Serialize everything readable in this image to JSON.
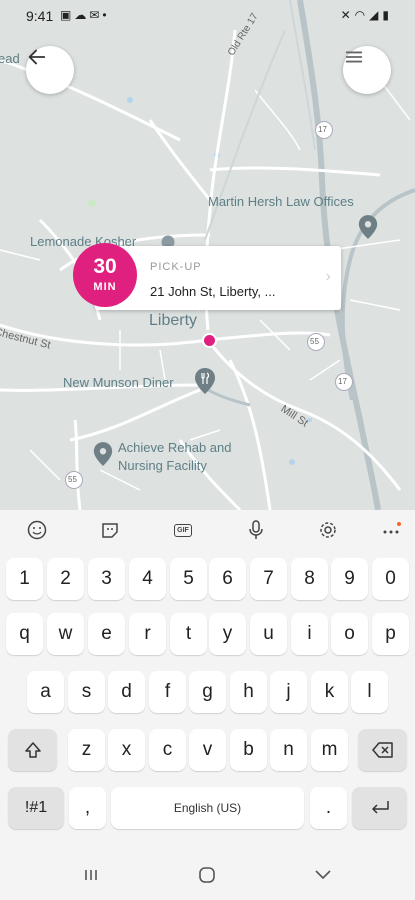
{
  "status_bar": {
    "time": "9:41",
    "left_icons": [
      "image-icon",
      "cloud-icon",
      "mail-icon",
      "dot-icon"
    ],
    "right_icons": [
      "mute-icon",
      "wifi-icon",
      "signal-icon",
      "battery-icon"
    ]
  },
  "map": {
    "labels": {
      "business_1": "Martin Hersh Law Offices",
      "business_2": "Lemonade Kosher",
      "town": "Liberty",
      "diner": "New Munson Diner",
      "rehab_line1": "Achieve Rehab and",
      "rehab_line2": "Nursing Facility",
      "partial_left": "ead"
    },
    "roads": {
      "old_rte": "Old Rte 17",
      "chestnut": "Chestnut St",
      "mill": "Mill St",
      "shield_17a": "17",
      "shield_17b": "17",
      "shield_55a": "55",
      "shield_55b": "55"
    },
    "colors": {
      "water": "#b4d4ec",
      "park": "#cde8c6",
      "roads": "#ffffff",
      "highway": "#b9c4c8",
      "pin": "#e0207e"
    }
  },
  "pickup": {
    "eta_value": "30",
    "eta_unit": "MIN",
    "title": "PICK-UP",
    "address": "21 John St, Liberty, ...",
    "chevron": "›"
  },
  "keyboard": {
    "toolbar": [
      "emoji-icon",
      "sticker-icon",
      "gif-icon",
      "microphone-icon",
      "settings-icon",
      "more-icon"
    ],
    "gif_label": "GIF",
    "row_numbers": [
      "1",
      "2",
      "3",
      "4",
      "5",
      "6",
      "7",
      "8",
      "9",
      "0"
    ],
    "row_1": [
      "q",
      "w",
      "e",
      "r",
      "t",
      "y",
      "u",
      "i",
      "o",
      "p"
    ],
    "row_2": [
      "a",
      "s",
      "d",
      "f",
      "g",
      "h",
      "j",
      "k",
      "l"
    ],
    "row_3": [
      "z",
      "x",
      "c",
      "v",
      "b",
      "n",
      "m"
    ],
    "symbols_label": "!#1",
    "comma_label": ",",
    "space_label": "English (US)",
    "period_label": "."
  },
  "nav": [
    "recent-apps-icon",
    "home-icon",
    "back-icon"
  ]
}
